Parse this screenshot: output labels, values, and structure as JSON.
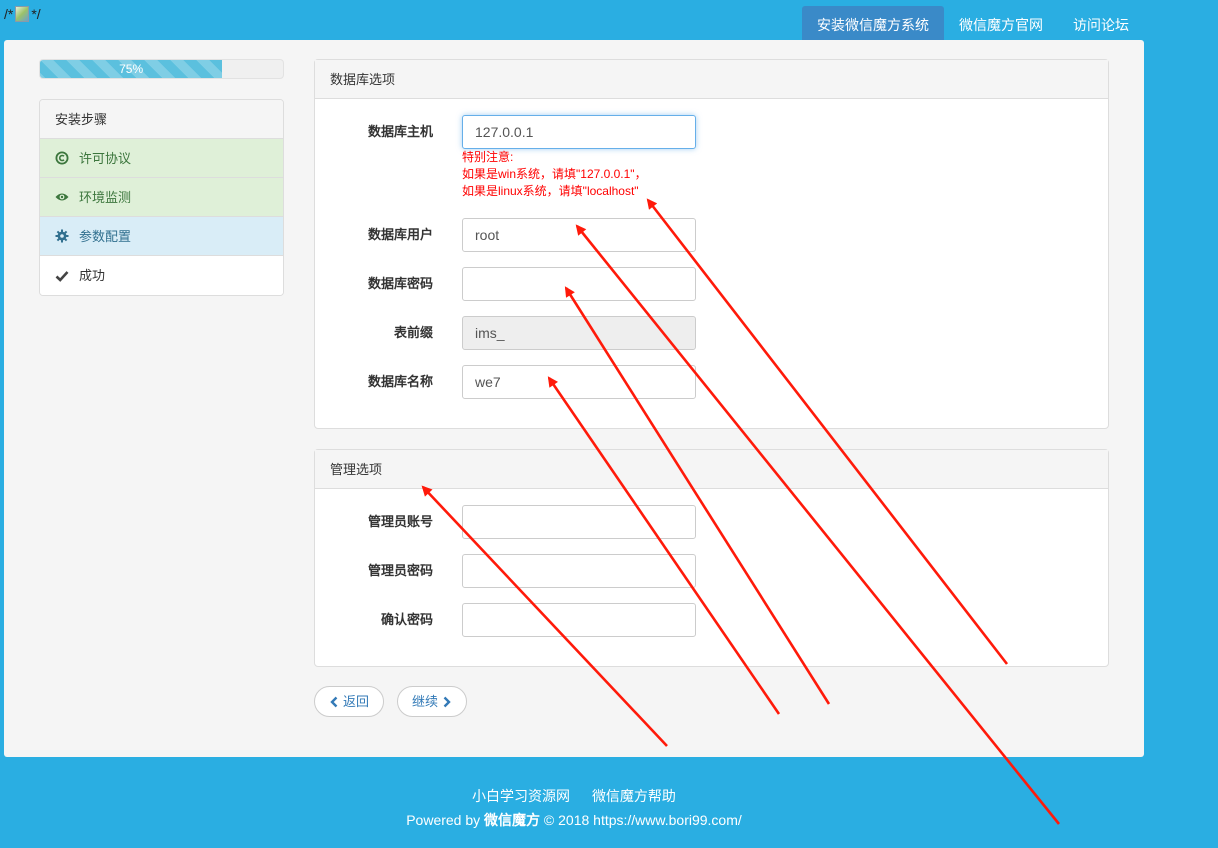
{
  "header": {
    "broken_image_prefix": "/*",
    "broken_image_suffix": "*/",
    "nav": [
      {
        "label": "安装微信魔方系统",
        "active": true
      },
      {
        "label": "微信魔方官网",
        "active": false
      },
      {
        "label": "访问论坛",
        "active": false
      }
    ]
  },
  "progress": {
    "label": "75%",
    "value": 75
  },
  "steps": {
    "title": "安装步骤",
    "items": [
      {
        "label": "许可协议",
        "state": "done",
        "icon": "copyright-icon"
      },
      {
        "label": "环境监测",
        "state": "done",
        "icon": "eye-icon"
      },
      {
        "label": "参数配置",
        "state": "current",
        "icon": "gear-icon"
      },
      {
        "label": "成功",
        "state": "todo",
        "icon": "check-icon"
      }
    ]
  },
  "db_panel": {
    "title": "数据库选项",
    "host_label": "数据库主机",
    "host_value": "127.0.0.1",
    "note_line1": "特别注意:",
    "note_line2": "如果是win系统，请填\"127.0.0.1\"，",
    "note_line3": "如果是linux系统，请填\"localhost\"",
    "user_label": "数据库用户",
    "user_value": "root",
    "password_label": "数据库密码",
    "password_value": "",
    "prefix_label": "表前缀",
    "prefix_value": "ims_",
    "name_label": "数据库名称",
    "name_value": "we7"
  },
  "admin_panel": {
    "title": "管理选项",
    "account_label": "管理员账号",
    "password_label": "管理员密码",
    "confirm_label": "确认密码"
  },
  "buttons": {
    "back": "返回",
    "next": "继续"
  },
  "footer": {
    "links": [
      "小白学习资源网",
      "微信魔方帮助"
    ],
    "powered_prefix": "Powered by ",
    "powered_brand": "微信魔方",
    "powered_suffix": " © 2018 https://www.bori99.com/"
  },
  "colors": {
    "background": "#2aaee2",
    "accent": "#3a8ac8",
    "arrow": "#ff1a0a"
  }
}
